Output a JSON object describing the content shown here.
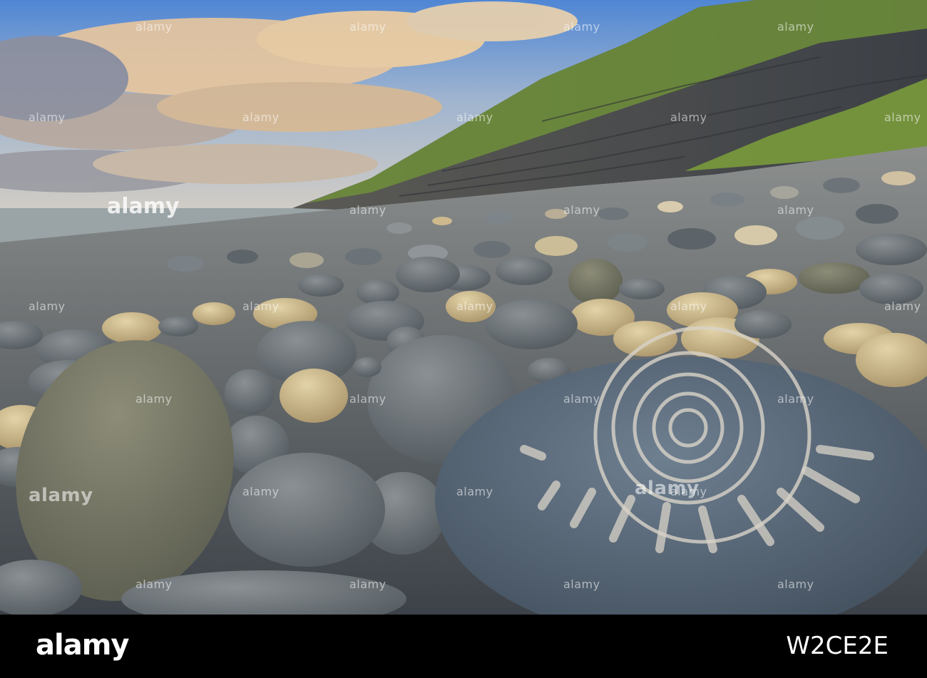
{
  "photo": {
    "subject": "",
    "colors": {
      "sky_top": "#5f8fd0",
      "sky_mid": "#c9b9a4",
      "cloud_warm": "#f2c68e",
      "cliff": "#4a4d52",
      "grass": "#6f8f3a",
      "sea": "#9aa4a8",
      "pebble_grey": "#6d7479",
      "pebble_tan": "#cdb98d",
      "boulder_blue": "#5b6a7a",
      "fossil_line": "#d9d3c8"
    }
  },
  "watermark": {
    "text": "alamy",
    "center_text": "alamy"
  },
  "footer": {
    "logo_text": "alamy",
    "image_id": "W2CE2E"
  }
}
